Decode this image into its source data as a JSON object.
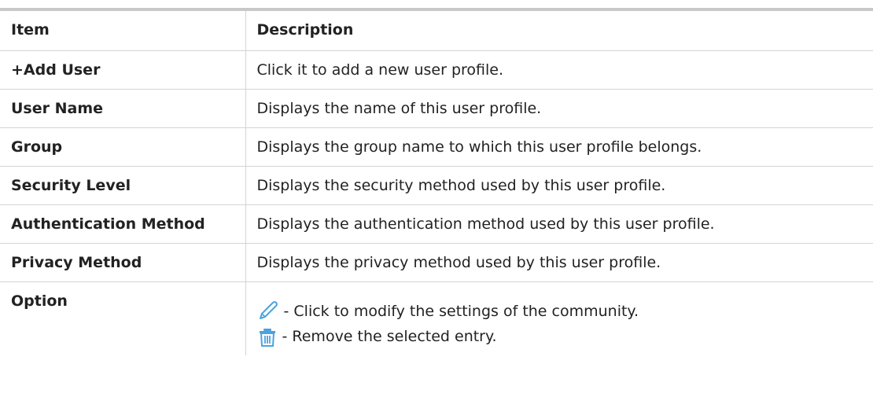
{
  "table": {
    "headers": {
      "item": "Item",
      "description": "Description"
    },
    "rows": [
      {
        "item": "+Add User",
        "description": "Click it to add a new user profile."
      },
      {
        "item": "User Name",
        "description": "Displays the name of this user profile."
      },
      {
        "item": "Group",
        "description": "Displays the group name to which this user profile belongs."
      },
      {
        "item": "Security Level",
        "description": "Displays the security method used by this user profile."
      },
      {
        "item": "Authentication Method",
        "description": "Displays the authentication method used by this user profile."
      },
      {
        "item": "Privacy Method",
        "description": "Displays the privacy method used by this user profile."
      }
    ],
    "option_row": {
      "item": "Option",
      "entries": [
        {
          "icon": "pencil-edit-icon",
          "text": "- Click to modify the settings of the community."
        },
        {
          "icon": "trash-delete-icon",
          "text": "- Remove the selected entry."
        }
      ]
    }
  },
  "colors": {
    "header_rule": "#c8c8c8",
    "grid": "#d4d4d4",
    "icon_blue": "#4aa3e0"
  }
}
